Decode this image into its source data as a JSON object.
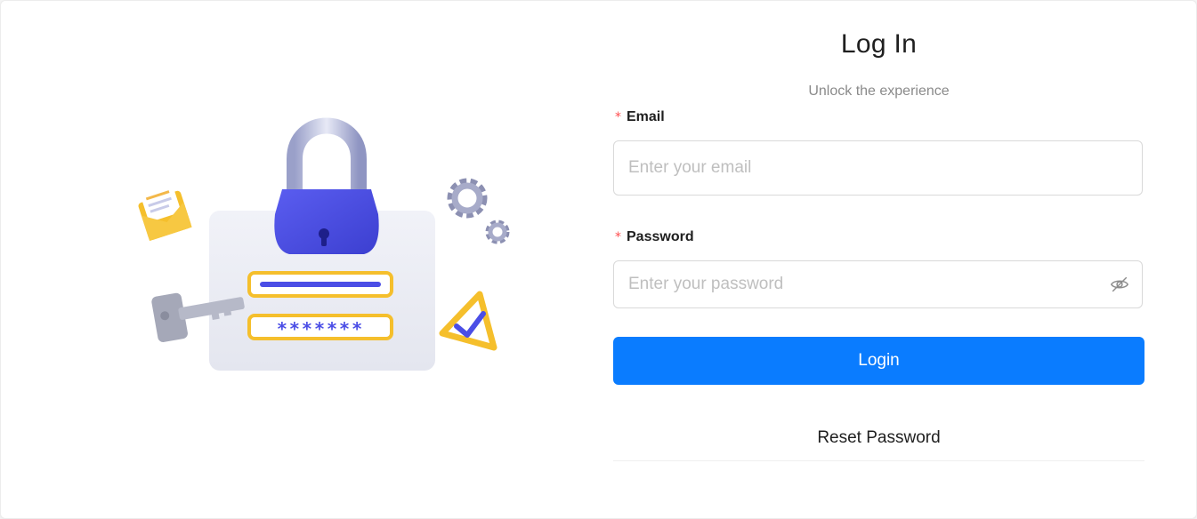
{
  "login": {
    "title": "Log In",
    "subtitle": "Unlock the experience",
    "email_label": "Email",
    "email_placeholder": "Enter your email",
    "email_value": "",
    "password_label": "Password",
    "password_placeholder": "Enter your password",
    "password_value": "",
    "required_marker": "*",
    "login_button": "Login",
    "reset_button": "Reset Password"
  },
  "illustration": {
    "password_mask": "*******",
    "icons": [
      "padlock-icon",
      "key-icon",
      "envelope-icon",
      "gear-icon",
      "warning-check-icon"
    ]
  },
  "icons": {
    "password_toggle": "eye-off-icon"
  },
  "colors": {
    "primary": "#0a7cff",
    "required": "#ff4d4f",
    "lock_body": "#4b4ee6",
    "accent_yellow": "#f5bf2c"
  }
}
